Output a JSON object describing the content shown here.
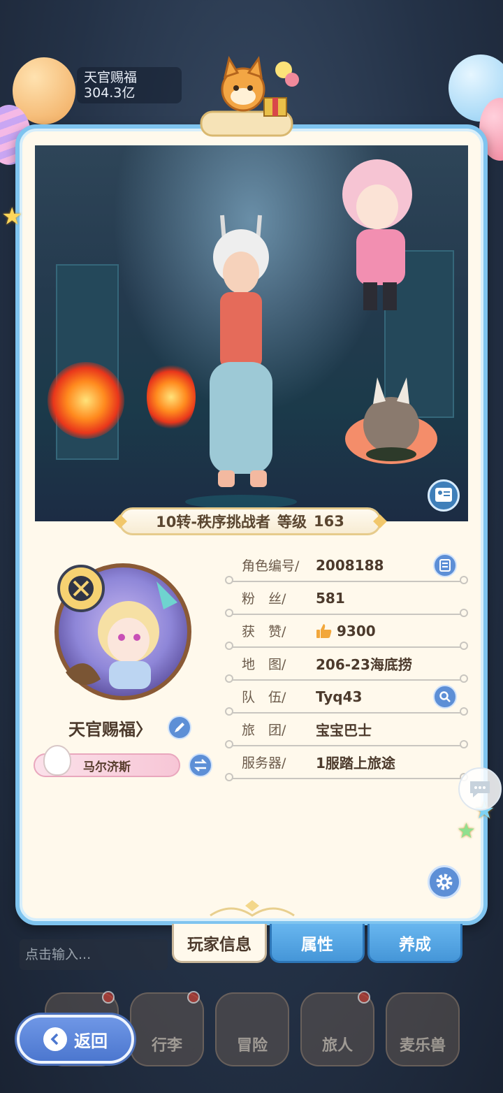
{
  "background": {
    "top_label_name": "天官赐福",
    "top_label_value": "304.3亿"
  },
  "portrait": {
    "rank_text": "10转-秩序挑战者",
    "level_label": "等级",
    "level_value": "163",
    "scene_icon": "portrait-switch-icon"
  },
  "player": {
    "nickname": "天官赐福〉",
    "title_badge": "马尔济斯",
    "edit_icon": "pencil-icon",
    "swap_icon": "swap-arrows-icon"
  },
  "info": {
    "rows": [
      {
        "label": "角色编号/",
        "value": "2008188",
        "button_icon": "list-icon"
      },
      {
        "label": "粉　丝/",
        "value": "581"
      },
      {
        "label": "获　赞/",
        "value": "9300",
        "icon": "thumbs-up-icon"
      },
      {
        "label": "地　图/",
        "value": "206-23海底捞"
      },
      {
        "label": "队　伍/",
        "value": "Tyq43",
        "button_icon": "search-icon"
      },
      {
        "label": "旅　团/",
        "value": "宝宝巴士"
      },
      {
        "label": "服务器/",
        "value": "1服踏上旅途"
      }
    ]
  },
  "tabs": [
    {
      "label": "玩家信息",
      "active": true
    },
    {
      "label": "属性",
      "active": false
    },
    {
      "label": "养成",
      "active": false
    }
  ],
  "chat": {
    "placeholder": "点击输入..."
  },
  "bottom_nav": [
    {
      "label": "",
      "has_dot": true
    },
    {
      "label": "行李",
      "has_dot": true
    },
    {
      "label": "冒险",
      "has_dot": false
    },
    {
      "label": "旅人",
      "has_dot": true
    },
    {
      "label": "麦乐兽",
      "has_dot": false
    }
  ],
  "back_button": {
    "label": "返回"
  },
  "colors": {
    "card_border": "#7fc4ef",
    "card_background": "#fff9ec",
    "button_blue": "#5d8fd6",
    "tab_blue": "#4596d8",
    "badge_dot": "#d73a2e"
  }
}
